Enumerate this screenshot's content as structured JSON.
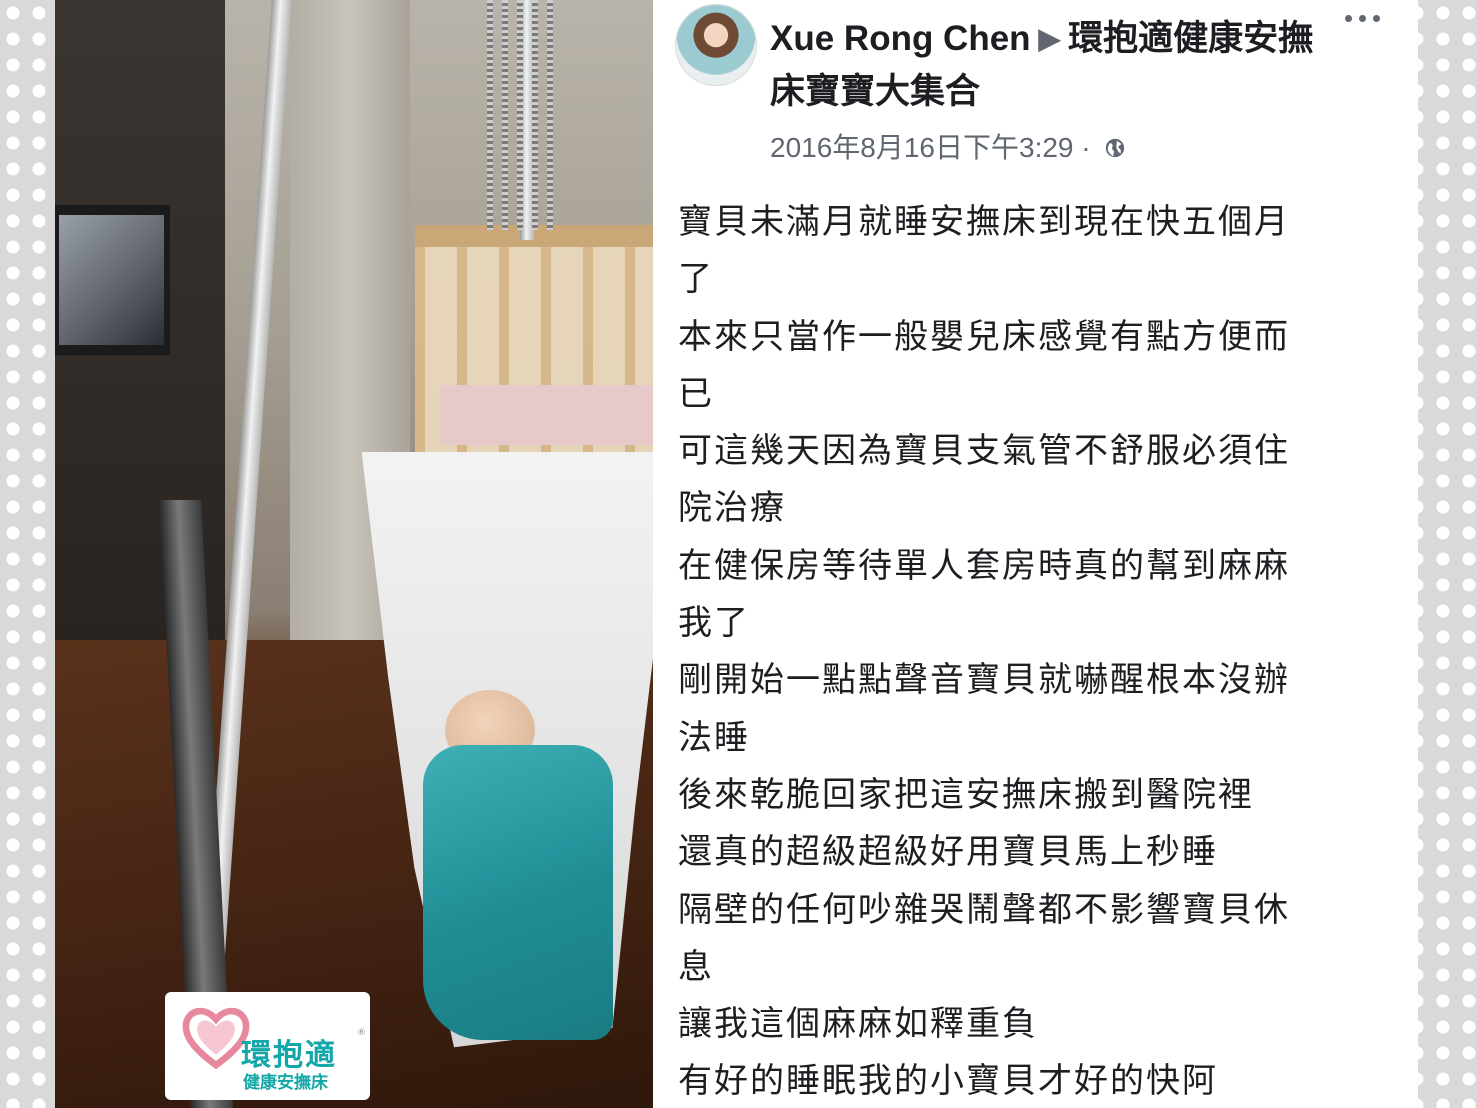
{
  "post": {
    "author": "Xue Rong Chen",
    "group": "環抱適健康安撫床寶寶大集合",
    "timestamp": "2016年8月16日下午3:29",
    "separator": "·",
    "lines": [
      "寶貝未滿月就睡安撫床到現在快五個月",
      "了",
      "本來只當作一般嬰兒床感覺有點方便而",
      "已",
      "可這幾天因為寶貝支氣管不舒服必須住",
      "院治療",
      "在健保房等待單人套房時真的幫到麻麻",
      "我了",
      "剛開始一點點聲音寶貝就嚇醒根本沒辦",
      "法睡",
      "後來乾脆回家把這安撫床搬到醫院裡",
      "還真的超級超級好用寶貝馬上秒睡",
      "隔壁的任何吵雜哭鬧聲都不影響寶貝休",
      "息",
      "讓我這個麻麻如釋重負",
      "有好的睡眠我的小寶貝才好的快阿"
    ]
  },
  "logo": {
    "brand": "環抱適",
    "tagline": "健康安撫床",
    "mark": "®"
  },
  "icons": {
    "privacy": "globe-icon",
    "menu": "more-options-icon",
    "arrow": "right-triangle-icon"
  },
  "colors": {
    "text": "#1c1e21",
    "muted": "#606770",
    "brand": "#14a7a8",
    "heart": "#e7889e"
  }
}
